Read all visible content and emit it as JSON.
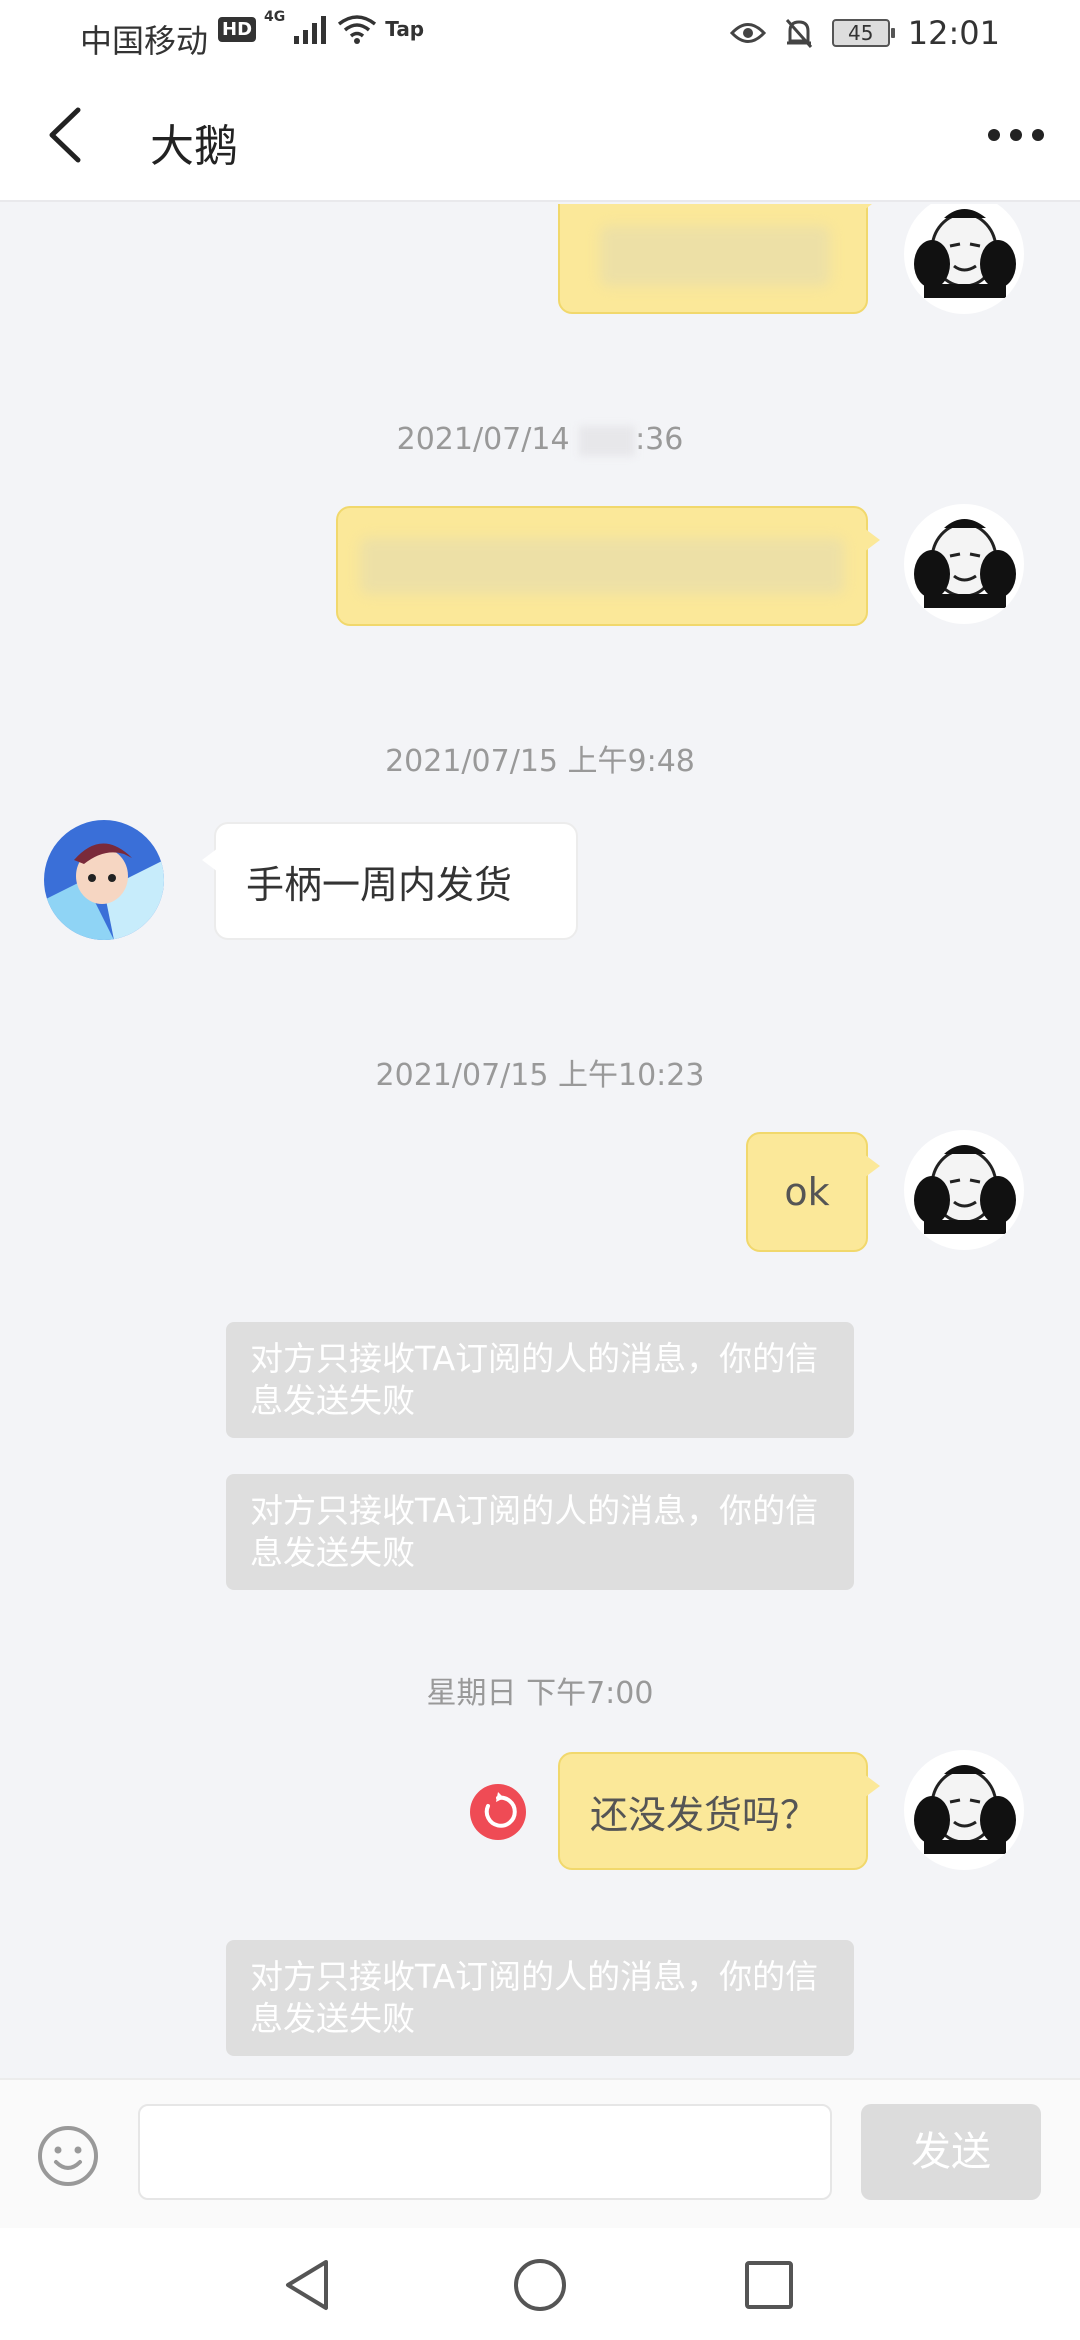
{
  "status_bar": {
    "carrier": "中国移动",
    "hd": "HD",
    "network": "4G",
    "tap": "Tap",
    "battery": "45",
    "time": "12:01"
  },
  "header": {
    "title": "大鹅"
  },
  "messages": {
    "ts1": "2021/07/14 ",
    "ts1_tail": ":36",
    "ts2": "2021/07/15 上午9:48",
    "other_msg": "手柄一周内发货",
    "ts3": "2021/07/15 上午10:23",
    "me_ok": "ok",
    "notice1": "对方只接收TA订阅的人的消息，你的信息发送失败",
    "notice2": "对方只接收TA订阅的人的消息，你的信息发送失败",
    "ts4": "星期日 下午7:00",
    "me_q": "还没发货吗？",
    "notice3": "对方只接收TA订阅的人的消息，你的信息发送失败"
  },
  "input_bar": {
    "placeholder": "",
    "send_label": "发送"
  },
  "colors": {
    "my_bubble": "#fbe899",
    "notice_bg": "#dedede",
    "retry": "#ef4b55"
  }
}
